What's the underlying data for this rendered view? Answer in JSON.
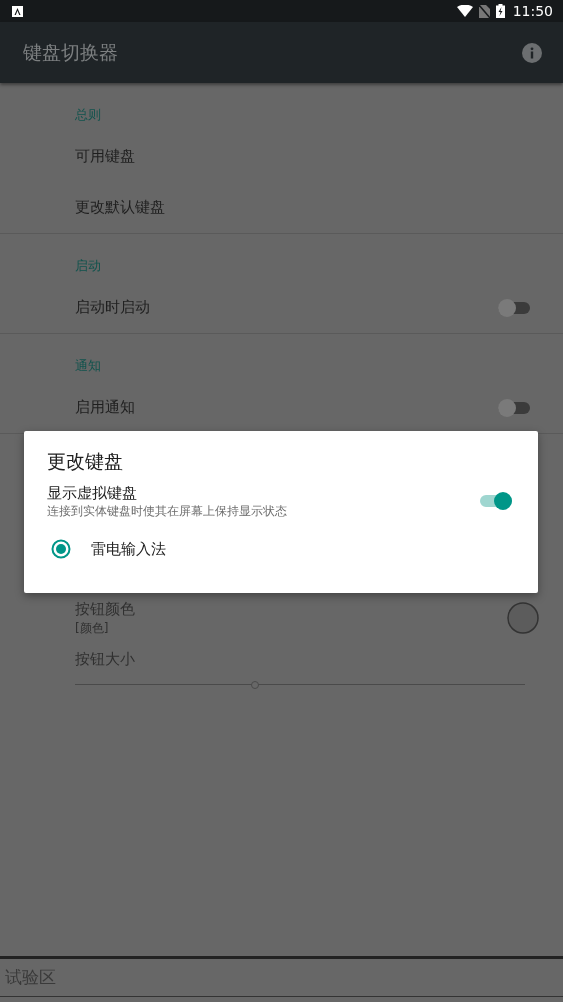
{
  "status_bar": {
    "time": "11:50"
  },
  "app_bar": {
    "title": "键盘切换器"
  },
  "sections": [
    {
      "header": "总则",
      "items": [
        {
          "kind": "plain",
          "title": "可用键盘"
        },
        {
          "kind": "plain",
          "title": "更改默认键盘"
        }
      ]
    },
    {
      "header": "启动",
      "items": [
        {
          "kind": "switch",
          "title": "启动时启动",
          "on": false
        }
      ]
    },
    {
      "header": "通知",
      "items": [
        {
          "kind": "switch",
          "title": "启用通知",
          "on": false
        }
      ]
    }
  ],
  "lower_items": [
    {
      "kind": "color",
      "title": "按钮颜色",
      "summary": "[颜色]"
    },
    {
      "kind": "slider",
      "title": "按钮大小",
      "level": 0.4
    }
  ],
  "bottom_section": {
    "title": "试验区"
  },
  "dialog": {
    "title": "更改键盘",
    "toggle": {
      "title": "显示虚拟键盘",
      "summary": "连接到实体键盘时使其在屏幕上保持显示状态",
      "on": true
    },
    "options": [
      {
        "label": "雷电输入法",
        "selected": true
      }
    ]
  }
}
